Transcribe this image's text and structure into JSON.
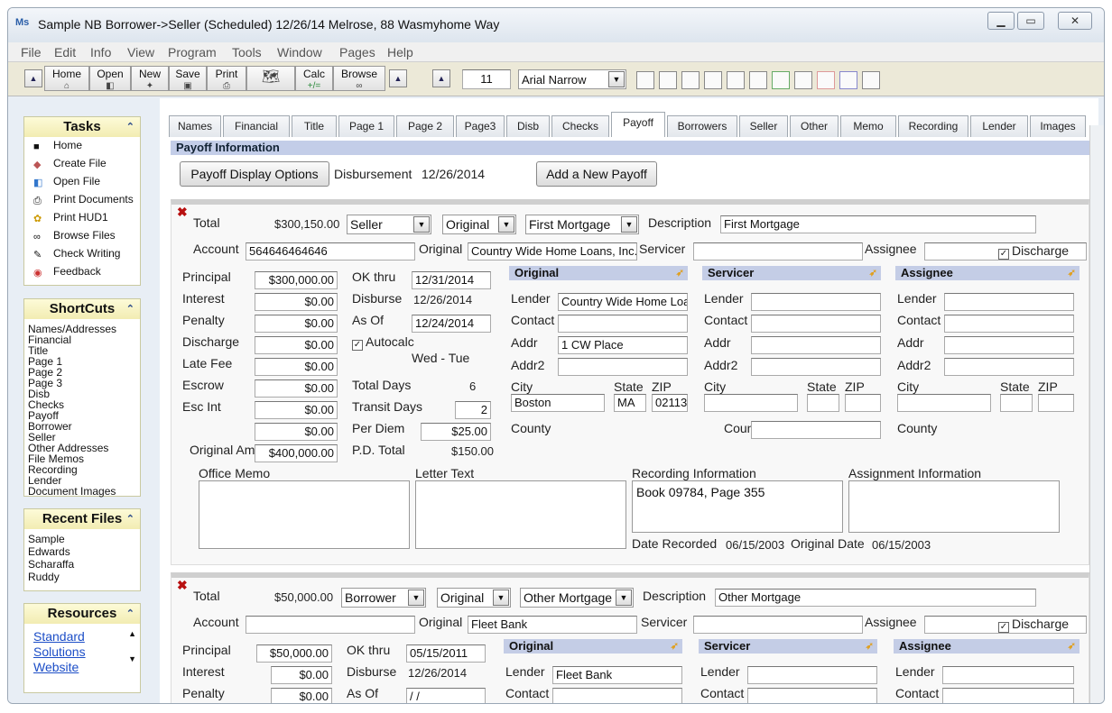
{
  "window": {
    "title": "Sample NB Borrower->Seller (Scheduled) 12/26/14 Melrose, 88 Wasmyhome Way",
    "app_icon": "Ms"
  },
  "menu": [
    "File",
    "Edit",
    "Info",
    "View",
    "Program",
    "Tools",
    "Window",
    "Pages",
    "Help"
  ],
  "toolbar": {
    "buttons": [
      "Home",
      "Open",
      "New",
      "Save",
      "Print",
      "Calc",
      "Browse"
    ],
    "calc_sub": "+/=",
    "font_size": "11",
    "font_name": "Arial Narrow"
  },
  "sidebar": {
    "tasks_title": "Tasks",
    "tasks": [
      "Home",
      "Create File",
      "Open File",
      "Print Documents",
      "Print HUD1",
      "Browse Files",
      "Check Writing",
      "Feedback"
    ],
    "shortcuts_title": "ShortCuts",
    "shortcuts": [
      "Names/Addresses",
      "Financial",
      "Title",
      "Page 1",
      "Page 2",
      "Page 3",
      "Disb",
      "Checks",
      "Payoff",
      "Borrower",
      "Seller",
      "Other Addresses",
      "File Memos",
      "Recording",
      "Lender",
      "Document Images"
    ],
    "recent_title": "Recent Files",
    "recent": [
      "Sample",
      "Edwards",
      "Scharaffa",
      "Ruddy"
    ],
    "resources_title": "Resources",
    "resources": [
      "Standard",
      "Solutions",
      "Website"
    ]
  },
  "tabs": [
    "Names",
    "Financial",
    "Title",
    "Page 1",
    "Page 2",
    "Page3",
    "Disb",
    "Checks",
    "Payoff",
    "Borrowers",
    "Seller",
    "Other",
    "Memo",
    "Recording",
    "Lender",
    "Images"
  ],
  "payoff": {
    "section_title": "Payoff Information",
    "display_options_button": "Payoff Display Options",
    "disbursement_label": "Disbursement",
    "disbursement_date": "12/26/2014",
    "add_button": "Add a New Payoff"
  },
  "labels": {
    "total": "Total",
    "description": "Description",
    "account": "Account",
    "original": "Original",
    "servicer": "Servicer",
    "assignee": "Assignee",
    "discharge": "Discharge",
    "principal": "Principal",
    "interest": "Interest",
    "penalty": "Penalty",
    "discharge_fee": "Discharge",
    "late_fee": "Late Fee",
    "escrow": "Escrow",
    "esc_int": "Esc Int",
    "original_amt": "Original Amt",
    "ok_thru": "OK thru",
    "disburse": "Disburse",
    "as_of": "As Of",
    "autocalc": "Autocalc",
    "total_days": "Total Days",
    "transit_days": "Transit Days",
    "per_diem": "Per Diem",
    "pd_total": "P.D. Total",
    "grp_original": "Original",
    "grp_servicer": "Servicer",
    "grp_assignee": "Assignee",
    "lender": "Lender",
    "contact": "Contact",
    "addr": "Addr",
    "addr2": "Addr2",
    "city": "City",
    "state": "State",
    "zip": "ZIP",
    "county": "County",
    "office_memo": "Office Memo",
    "letter_text": "Letter Text",
    "recording_info": "Recording Information",
    "assignment_info": "Assignment Information",
    "date_recorded": "Date Recorded",
    "original_date": "Original Date"
  },
  "record1": {
    "total": "$300,150.00",
    "payer": "Seller",
    "type": "Original",
    "mortgage": "First Mortgage",
    "description": "First Mortgage",
    "account": "564646464646",
    "original_lender_name": "Country Wide Home Loans, Inc.-P",
    "principal": "$300,000.00",
    "interest": "$0.00",
    "penalty": "$0.00",
    "discharge": "$0.00",
    "late_fee": "$0.00",
    "escrow": "$0.00",
    "esc_int": "$0.00",
    "extra": "$0.00",
    "original_amt": "$400,000.00",
    "ok_thru": "12/31/2014",
    "disburse": "12/26/2014",
    "as_of": "12/24/2014",
    "days_range": "Wed  - Tue",
    "total_days": "6",
    "transit_days": "2",
    "per_diem": "$25.00",
    "pd_total": "$150.00",
    "orig_lender": "Country Wide Home Loan",
    "orig_addr": "1 CW Place",
    "orig_city": "Boston",
    "orig_state": "MA",
    "orig_zip": "02113",
    "recording_info": "Book 09784, Page 355",
    "date_recorded": "06/15/2003",
    "original_date": "06/15/2003"
  },
  "record2": {
    "total": "$50,000.00",
    "payer": "Borrower",
    "type": "Original",
    "mortgage": "Other Mortgage",
    "description": "Other Mortgage",
    "original_lender_name": "Fleet Bank",
    "principal": "$50,000.00",
    "interest": "$0.00",
    "penalty": "$0.00",
    "ok_thru": "05/15/2011",
    "disburse": "12/26/2014",
    "as_of": " / /",
    "orig_lender": "Fleet Bank"
  }
}
